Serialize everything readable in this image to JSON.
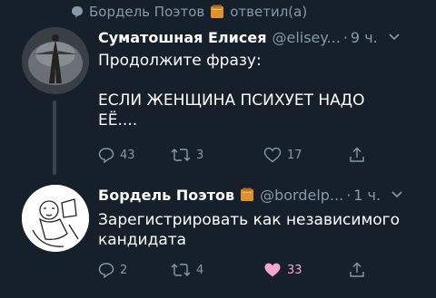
{
  "retweet_banner": {
    "author": "Бордель Поэтов",
    "suffix": "ответил(а)",
    "icon": "speech-bubble-icon",
    "emoji": "folder-icon"
  },
  "tweet1": {
    "name": "Суматошная Елисея",
    "handle": "@elisey...",
    "time": "9 ч.",
    "text": "Продолжите фразу:\n\nЕСЛИ ЖЕНЩИНА ПСИХУЕТ НАДО\nЕЁ....",
    "reply_count": "43",
    "retweet_count": "3",
    "like_count": "17"
  },
  "tweet2": {
    "name": "Бордель Поэтов",
    "handle": "@bordelp...",
    "time": "1 ч.",
    "text": "Зарегистрировать как независимого\nкандидата",
    "reply_count": "2",
    "retweet_count": "4",
    "like_count": "33",
    "liked": true
  },
  "colors": {
    "background": "#15202b",
    "secondary_text": "#8899a6",
    "like_active": "#f4a6cf"
  }
}
